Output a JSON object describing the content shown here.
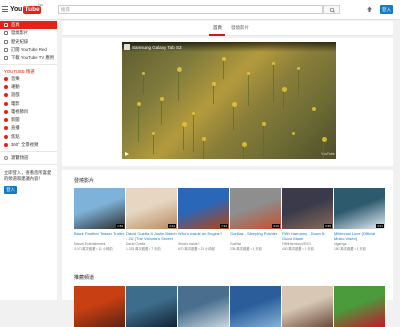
{
  "header": {
    "logo_you": "You",
    "logo_tube": "Tube",
    "logo_region": "TW",
    "search_placeholder": "搜尋",
    "signin_label": "登入"
  },
  "sidebar": {
    "items": [
      {
        "label": "首頁",
        "icon": "home-icon",
        "active": true
      },
      {
        "label": "發燒影片",
        "icon": "trending-icon"
      },
      {
        "label": "歷史紀錄",
        "icon": "history-icon"
      },
      {
        "label": "訂閱 YouTube Red",
        "icon": "youtube-red-icon"
      },
      {
        "label": "下載 YouTube TV 應用",
        "icon": "tv-icon"
      }
    ],
    "heading": "YOUTUBE 精選",
    "channels": [
      {
        "label": "音樂",
        "icon": "music-channel-icon",
        "color": "#e62117"
      },
      {
        "label": "運動",
        "icon": "sports-channel-icon",
        "color": "#e62117"
      },
      {
        "label": "遊戲",
        "icon": "gaming-channel-icon",
        "color": "#e62117"
      },
      {
        "label": "電影",
        "icon": "movies-channel-icon",
        "color": "#e62117"
      },
      {
        "label": "電視節目",
        "icon": "tv-shows-channel-icon",
        "color": "#e62117"
      },
      {
        "label": "新聞",
        "icon": "news-channel-icon",
        "color": "#e62117"
      },
      {
        "label": "直播",
        "icon": "live-channel-icon",
        "color": "#e62117"
      },
      {
        "label": "焦點",
        "icon": "spotlight-channel-icon",
        "color": "#e62117"
      },
      {
        "label": "360° 全景視頻",
        "icon": "360-video-channel-icon",
        "color": "#e62117"
      }
    ],
    "browse_channels": "瀏覽頻道",
    "promo_text": "立即登入，查看您所喜愛的頻道和建議內容！",
    "signin_label": "登入"
  },
  "tabs": [
    {
      "label": "首頁",
      "active": true
    },
    {
      "label": "發燒影片",
      "active": false
    }
  ],
  "featured_video": {
    "title": "Samsung Galaxy Tab S3",
    "brand_mark": "YouTube"
  },
  "sections": [
    {
      "title": "發燒影片",
      "videos": [
        {
          "title": "Black Panther Teaser Trailer",
          "channel": "Marvel Entertainment",
          "meta": "3,071萬次觀看 • 11 小時前",
          "duration": "1:53",
          "colors": [
            "#7fb2d8",
            "#2b2b2b"
          ]
        },
        {
          "title": "David Guetta ft Justin Bieber - 2U (The Victoria's Secret Angels Lip",
          "channel": "David Guetta",
          "meta": "1,315 萬次觀看 • 7 天前",
          "duration": "3:34",
          "colors": [
            "#e6d6c2",
            "#b9895c"
          ]
        },
        {
          "title": "Who's Inside an Engine?",
          "channel": "What's Inside?",
          "meta": "670 萬次觀看 • 21 小時前",
          "duration": "7:34",
          "colors": [
            "#2b67b8",
            "#b7410e"
          ]
        },
        {
          "title": "Gorillaz - Sleeping Powder",
          "channel": "Gorillaz",
          "meta": "236 萬次觀看 • 1 天前",
          "duration": "3:02",
          "colors": [
            "#8e8e8e",
            "#c94d2c"
          ]
        },
        {
          "title": "Fifth Harmony - Down ft. Gucci Mane",
          "channel": "FifthHarmonyVEVO",
          "meta": "430 萬次觀看 • 1 天前",
          "duration": "3:55",
          "colors": [
            "#3a3a4a",
            "#8c6a5a"
          ]
        },
        {
          "title": "Millennial Love (Official Music Video)",
          "channel": "nigahiga",
          "meta": "160 萬次觀看 • 1 天前",
          "duration": "3:21",
          "colors": [
            "#2e5a6e",
            "#e5eef5"
          ]
        }
      ]
    },
    {
      "title": "推薦頻道",
      "videos": [
        {
          "colors": [
            "#c73f12",
            "#5b2212"
          ]
        },
        {
          "colors": [
            "#3e6d8c",
            "#112233"
          ]
        },
        {
          "colors": [
            "#4a6f8e",
            "#c9d7e0"
          ]
        },
        {
          "colors": [
            "#2a5d9a",
            "#86b3da"
          ]
        },
        {
          "colors": [
            "#d8c7b5",
            "#6b4a3a"
          ]
        },
        {
          "colors": [
            "#4b9a3b",
            "#c3162d"
          ]
        }
      ]
    }
  ]
}
